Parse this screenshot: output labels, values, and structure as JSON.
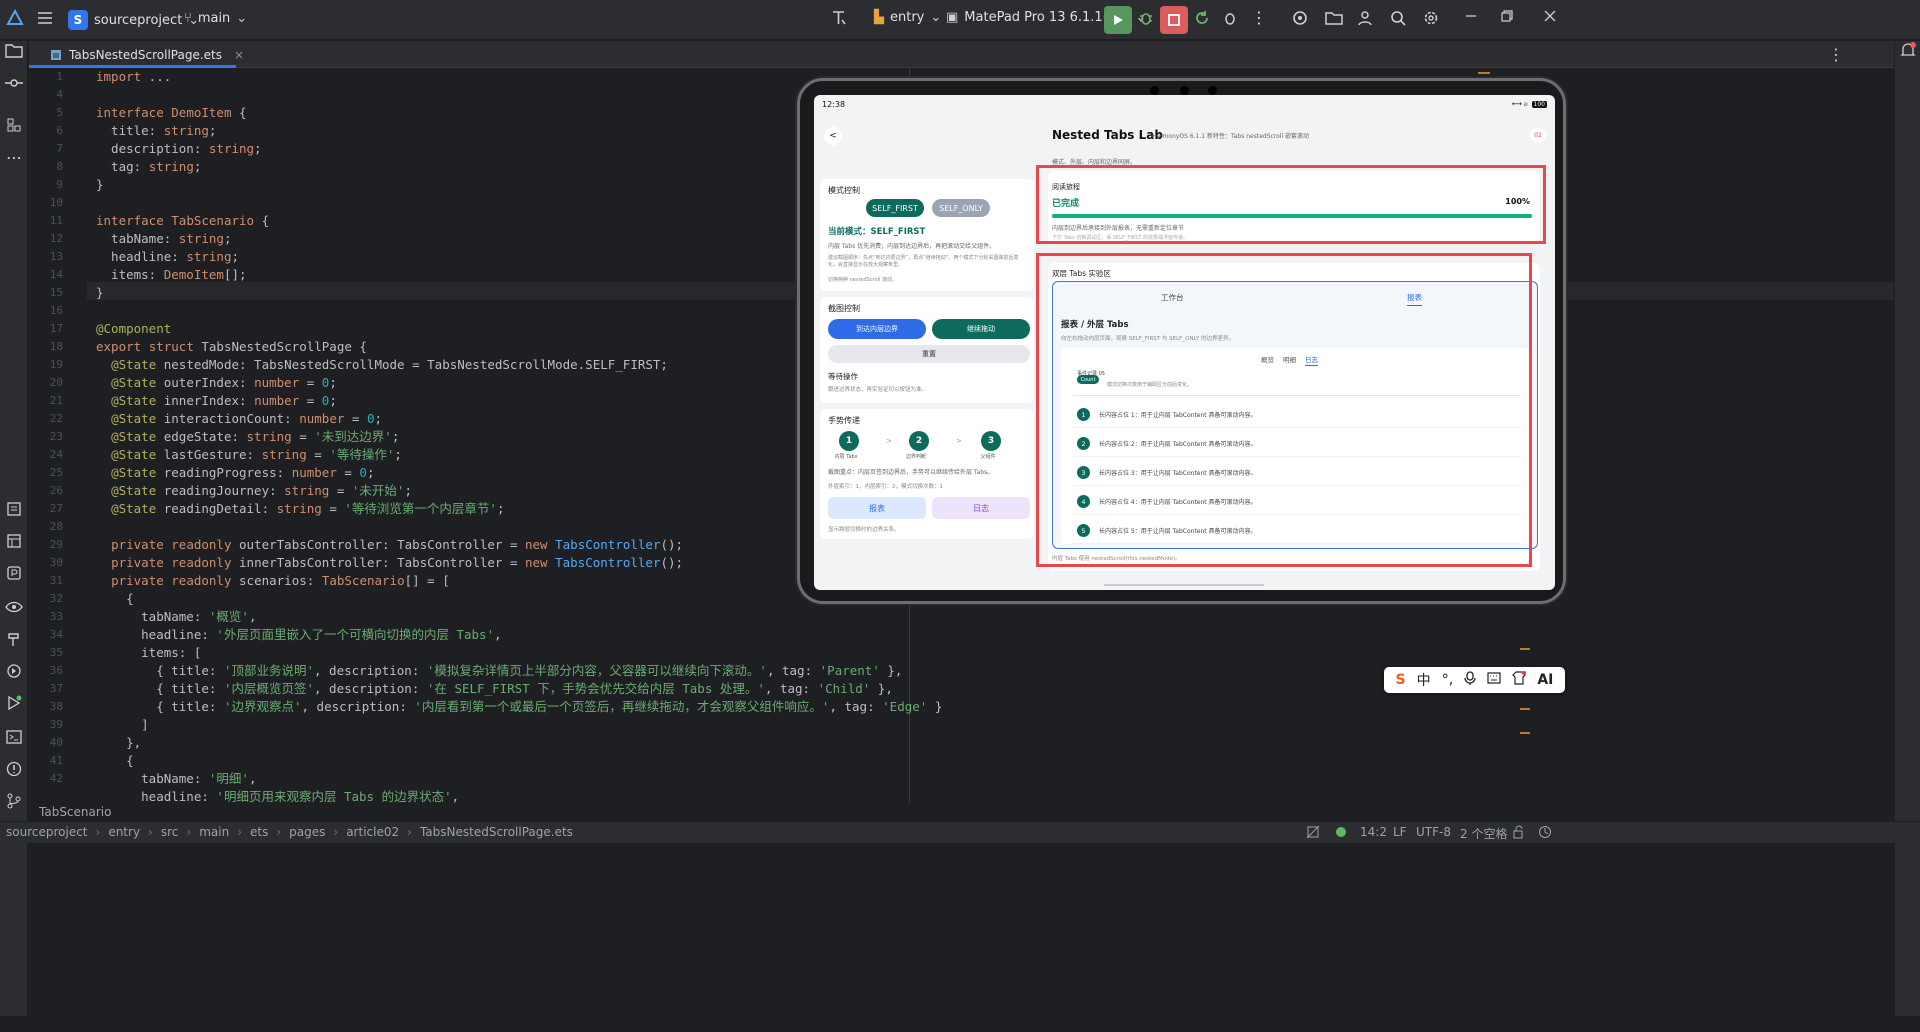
{
  "titlebar": {
    "project": "sourceproject",
    "project_badge": "S",
    "branch": "main",
    "module": "entry",
    "device": "MatePad Pro 13 6.1.1(24)"
  },
  "tab": {
    "filename": "TabsNestedScrollPage.ets"
  },
  "editor": {
    "line_numbers": [
      "1",
      "4",
      "5",
      "6",
      "7",
      "8",
      "9",
      "10",
      "11",
      "12",
      "13",
      "14",
      "15",
      "16",
      "17",
      "18",
      "19",
      "20",
      "21",
      "22",
      "23",
      "24",
      "25",
      "26",
      "27",
      "28",
      "29",
      "30",
      "31",
      "32",
      "33",
      "34",
      "35",
      "36",
      "37",
      "38",
      "39",
      "40",
      "41",
      "42"
    ],
    "code_lines": [
      "import ...",
      "",
      "interface DemoItem {",
      "  title: string;",
      "  description: string;",
      "  tag: string;",
      "}",
      "",
      "interface TabScenario {",
      "  tabName: string;",
      "  headline: string;",
      "  items: DemoItem[];",
      "}",
      "",
      "@Component",
      "export struct TabsNestedScrollPage {",
      "  @State nestedMode: TabsNestedScrollMode = TabsNestedScrollMode.SELF_FIRST;",
      "  @State outerIndex: number = 0;",
      "  @State innerIndex: number = 0;",
      "  @State interactionCount: number = 0;",
      "  @State edgeState: string = '未到达边界';",
      "  @State lastGesture: string = '等待操作';",
      "  @State readingProgress: number = 0;",
      "  @State readingJourney: string = '未开始';",
      "  @State readingDetail: string = '等待浏览第一个内层章节';",
      "",
      "  private readonly outerTabsController: TabsController = new TabsController();",
      "  private readonly innerTabsController: TabsController = new TabsController();",
      "  private readonly scenarios: TabScenario[] = [",
      "    {",
      "      tabName: '概览',",
      "      headline: '外层页面里嵌入了一个可横向切换的内层 Tabs',",
      "      items: [",
      "        { title: '顶部业务说明', description: '模拟复杂详情页上半部分内容，父容器可以继续向下滚动。', tag: 'Parent' },",
      "        { title: '内层概览页签', description: '在 SELF_FIRST 下，手势会优先交给内层 Tabs 处理。', tag: 'Child' },",
      "        { title: '边界观察点', description: '内层看到第一个或最后一个页签后，再继续拖动，才会观察父组件响应。', tag: 'Edge' }",
      "      ]",
      "    },",
      "    {",
      "      tabName: '明细',",
      "      headline: '明细页用来观察内层 Tabs 的边界状态',"
    ]
  },
  "bottom_breadcrumb": "TabScenario",
  "statusbar": {
    "path": [
      "sourceproject",
      "entry",
      "src",
      "main",
      "ets",
      "pages",
      "article02",
      "TabsNestedScrollPage.ets"
    ],
    "position": "14:2",
    "line_ending": "LF",
    "encoding": "UTF-8",
    "indent": "2 个空格"
  },
  "device": {
    "time": "12:38",
    "battery": "100",
    "back": "<",
    "title": "Nested Tabs Lab",
    "subtitle": "HarmonyOS 6.1.1 新特性：Tabs nestedScroll 嵌套滚动",
    "badge": "02",
    "top_snippet": "模式、外层、内层和边界同屏。",
    "mode_card": {
      "heading": "模式控制",
      "btn_self_first": "SELF_FIRST",
      "btn_self_only": "SELF_ONLY",
      "current": "当前模式：SELF_FIRST",
      "desc": "内层 Tabs 优先消费；内层到达边界后，再把滚动交给父组件。",
      "hint": "建议截图顺序：先点“到达内层边界”，再点“继续拖动”。两个模式下分别采图做前后变化，会直接显示在放大观察条里。",
      "switch_hint": "切换两种 nestedScroll 滚动。"
    },
    "screenshot_card": {
      "heading": "截图控制",
      "btn_reach": "到达内层边界",
      "btn_continue": "继续拖动",
      "btn_reset": "重置",
      "wait_heading": "等待操作",
      "wait_desc": "跟进边界状态，再实验证切以按钮为准。"
    },
    "gesture_card": {
      "heading": "手势传递",
      "steps": [
        {
          "num": "1",
          "label": "内层 Tabs"
        },
        {
          "num": "2",
          "label": "边界判断"
        },
        {
          "num": "3",
          "label": "父组件"
        }
      ],
      "arrow": ">",
      "focus": "截图重点：内层页签到边界后，手势可以继续传给外层 Tabs。",
      "index_info": "外层索引：1，内层索引：2，模式切换次数：1",
      "btn_report": "报表",
      "btn_log": "日志",
      "foot": "显示跨层切换时的边界关系。"
    },
    "reading": {
      "heading": "阅读旅程",
      "status": "已完成",
      "percent": "100%",
      "progress": 1.0,
      "desc": "内层到边界后承接到外层报表，无需重新定位章节",
      "desc2": "下方 Tabs 切换调试区，保 SELF_FIRST 的效果或浮窗传递。"
    },
    "lab": {
      "heading": "双层 Tabs 实验区",
      "outer_tabs": [
        "工作台",
        "报表"
      ],
      "outer_active": 1,
      "section_title": "报表 / 外层 Tabs",
      "section_desc": "向左右拖动内层页面，观察 SELF_FIRST 与 SELF_ONLY 的边界差异。",
      "inner_tabs": [
        "概览",
        "明细",
        "日志"
      ],
      "inner_active": 2,
      "count_badge": "Count",
      "count_title": "事件记录 05",
      "count_desc": "模式切换次数用于辅助区分前后变化。",
      "items": [
        {
          "num": "1",
          "text": "长内容占位 1：用于让内层 TabContent 具备可滚动内容。"
        },
        {
          "num": "2",
          "text": "长内容占位 2：用于让内层 TabContent 具备可滚动内容。"
        },
        {
          "num": "3",
          "text": "长内容占位 3：用于让内层 TabContent 具备可滚动内容。"
        },
        {
          "num": "4",
          "text": "长内容占位 4：用于让内层 TabContent 具备可滚动内容。"
        },
        {
          "num": "5",
          "text": "长内容占位 5：用于让内层 TabContent 具备可滚动内容。"
        }
      ],
      "footer": "内层 Tabs 使用 nestedScroll(this.nestedMode)。"
    }
  },
  "ime": {
    "items": [
      "S",
      "中",
      "°,",
      "mic",
      "kbd",
      "shirt",
      "AI"
    ]
  },
  "colors": {
    "accent": "#3574f0",
    "teal": "#0d6b5e",
    "device_blue": "#2f6be6",
    "highlight_red": "#e8474b",
    "progress_green": "#12b07a"
  }
}
